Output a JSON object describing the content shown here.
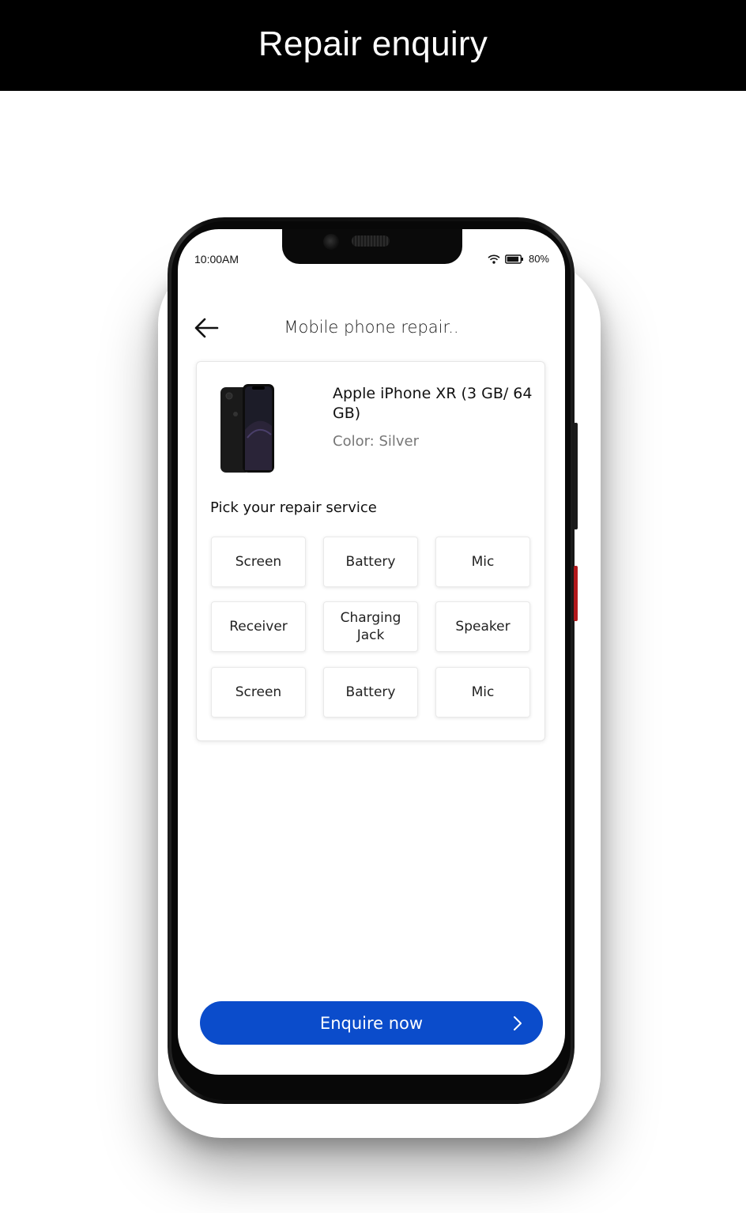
{
  "banner": {
    "title": "Repair enquiry"
  },
  "status_bar": {
    "time": "10:00AM",
    "battery": "80%"
  },
  "header": {
    "title": "Mobile phone repair.."
  },
  "product": {
    "name": "Apple iPhone XR (3 GB/ 64 GB)",
    "color": "Color: Silver"
  },
  "services": {
    "label": "Pick your repair service",
    "items": [
      {
        "label": "Screen"
      },
      {
        "label": "Battery"
      },
      {
        "label": "Mic"
      },
      {
        "label": "Receiver"
      },
      {
        "label": "Charging Jack"
      },
      {
        "label": "Speaker"
      },
      {
        "label": "Screen"
      },
      {
        "label": "Battery"
      },
      {
        "label": "Mic"
      }
    ]
  },
  "cta": {
    "label": "Enquire now"
  },
  "icons": {
    "back": "arrow-left-icon",
    "wifi": "wifi-icon",
    "battery": "battery-icon",
    "cta": "chevron-right-icon"
  },
  "colors": {
    "accent": "#0b4ccb",
    "banner": "#000000"
  }
}
